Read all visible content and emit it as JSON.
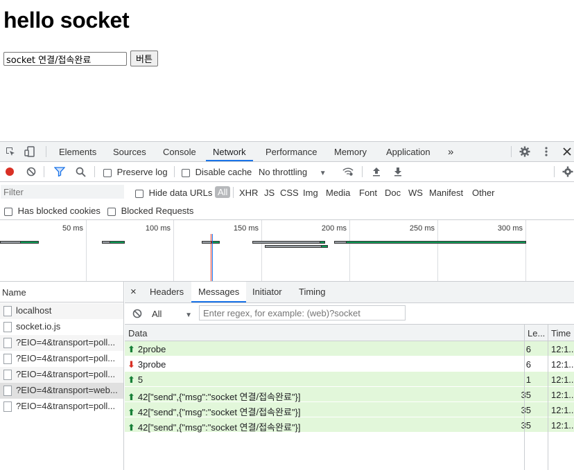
{
  "page": {
    "heading": "hello socket",
    "input_value": "socket 연결/접속완료",
    "button_label": "버튼"
  },
  "devtools": {
    "tabs": [
      "Elements",
      "Sources",
      "Console",
      "Network",
      "Performance",
      "Memory",
      "Application"
    ],
    "more_tabs_glyph": "»",
    "active_tab": "Network",
    "toolbar": {
      "preserve_log": "Preserve log",
      "disable_cache": "Disable cache",
      "throttling": "No throttling"
    },
    "filter": {
      "placeholder": "Filter",
      "hide_data_urls": "Hide data URLs",
      "types": [
        "All",
        "XHR",
        "JS",
        "CSS",
        "Img",
        "Media",
        "Font",
        "Doc",
        "WS",
        "Manifest",
        "Other"
      ],
      "has_blocked_cookies": "Has blocked cookies",
      "blocked_requests": "Blocked Requests"
    },
    "timeline": {
      "ticks": [
        "50 ms",
        "100 ms",
        "150 ms",
        "200 ms",
        "250 ms",
        "300 ms"
      ]
    },
    "requests": {
      "header": "Name",
      "items": [
        "localhost",
        "socket.io.js",
        "?EIO=4&transport=poll...",
        "?EIO=4&transport=poll...",
        "?EIO=4&transport=poll...",
        "?EIO=4&transport=web...",
        "?EIO=4&transport=poll..."
      ]
    },
    "detail_tabs": [
      "Headers",
      "Messages",
      "Initiator",
      "Timing"
    ],
    "active_detail_tab": "Messages",
    "messages": {
      "filter_select": "All",
      "regex_placeholder": "Enter regex, for example: (web)?socket",
      "columns": {
        "data": "Data",
        "length": "Le...",
        "time": "Time"
      },
      "rows": [
        {
          "direction": "sent",
          "data": "2probe",
          "length": "6",
          "time": "12:1..."
        },
        {
          "direction": "received",
          "data": "3probe",
          "length": "6",
          "time": "12:1..."
        },
        {
          "direction": "sent",
          "data": "5",
          "length": "1",
          "time": "12:1..."
        },
        {
          "direction": "sent",
          "data": "42[\"send\",{\"msg\":\"socket 연결/접속완료\"}]",
          "length": "35",
          "time": "12:1..."
        },
        {
          "direction": "sent",
          "data": "42[\"send\",{\"msg\":\"socket 연결/접속완료\"}]",
          "length": "35",
          "time": "12:1..."
        },
        {
          "direction": "sent",
          "data": "42[\"send\",{\"msg\":\"socket 연결/접속완료\"}]",
          "length": "35",
          "time": "12:1..."
        }
      ]
    }
  },
  "colors": {
    "accent": "#1a73e8",
    "record": "#d93025",
    "sent_row": "#e2f7da",
    "timeline_bar": "#0f9d58"
  }
}
